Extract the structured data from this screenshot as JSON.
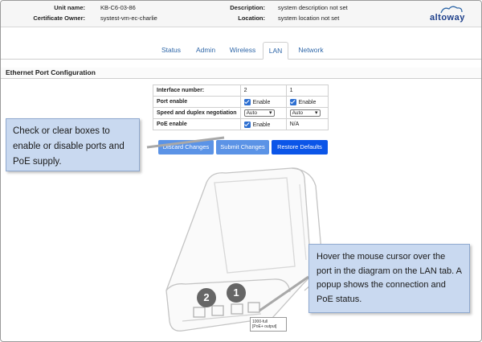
{
  "header": {
    "unit_name_label": "Unit name:",
    "unit_name_value": "KB-C6-03-86",
    "certificate_owner_label": "Certificate Owner:",
    "certificate_owner_value": "systest-vm-ec-charlie",
    "description_label": "Description:",
    "description_value": "system description not set",
    "location_label": "Location:",
    "location_value": "system location not set",
    "logo_text": "altoway"
  },
  "tabs": [
    {
      "label": "Status"
    },
    {
      "label": "Admin"
    },
    {
      "label": "Wireless"
    },
    {
      "label": "LAN",
      "active": true
    },
    {
      "label": "Network"
    }
  ],
  "section_title": "Ethernet Port Configuration",
  "table": {
    "header_label": "Interface number:",
    "col1": "2",
    "col2": "1",
    "rows": [
      {
        "label": "Port enable",
        "col1": "Enable",
        "col2": "Enable"
      },
      {
        "label": "Speed and duplex negotiation",
        "col1": "Auto",
        "col2": "Auto"
      },
      {
        "label": "PoE enable",
        "col1": "Enable",
        "col2": "N/A"
      }
    ]
  },
  "buttons": {
    "discard": "Discard Changes",
    "submit": "Submit Changes",
    "restore": "Restore Defaults"
  },
  "callouts": {
    "left": "Check or clear boxes to enable or disable ports and PoE supply.",
    "right": "Hover the mouse cursor over the port in the diagram on the LAN tab. A popup shows the connection and PoE status."
  },
  "diagram": {
    "port2_label": "2",
    "port1_label": "1",
    "popup_line1": "1000-full",
    "popup_line2": "[PoE+ output]"
  },
  "colors": {
    "tab_text": "#2f67a8",
    "button_light": "#5b93e6",
    "button_dark": "#0b55e8",
    "checkbox": "#2d6fd1",
    "callout_bg": "#c9d9f0"
  }
}
